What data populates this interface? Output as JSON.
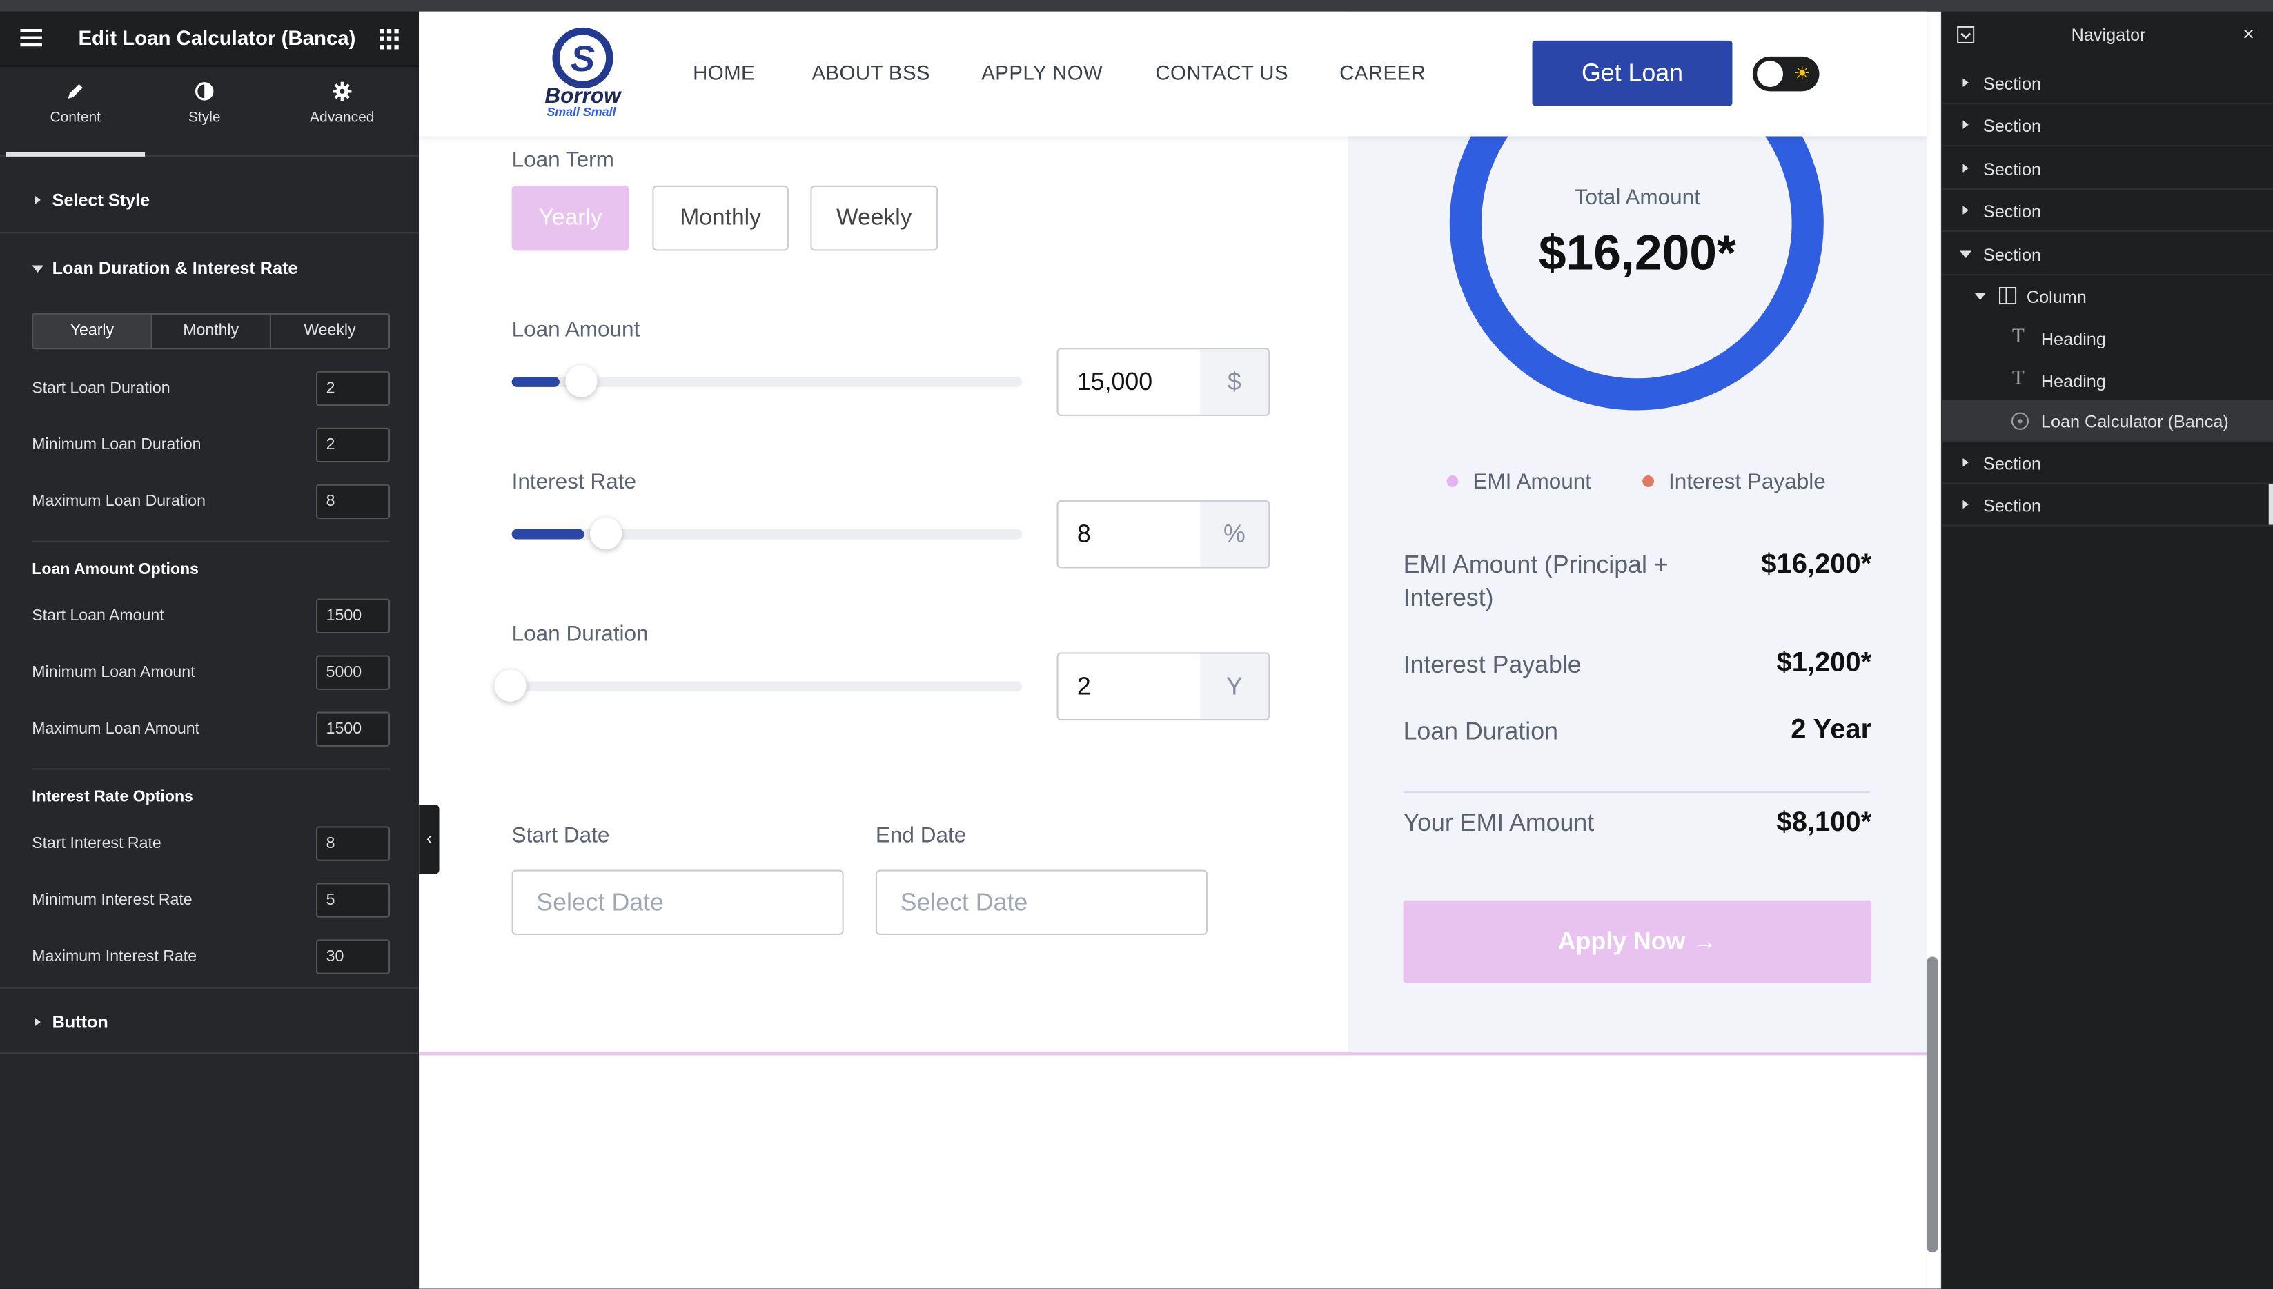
{
  "left_panel": {
    "title": "Edit Loan Calculator (Banca)",
    "tabs": [
      {
        "label": "Content"
      },
      {
        "label": "Style"
      },
      {
        "label": "Advanced"
      }
    ],
    "sections": [
      {
        "label": "Select Style"
      },
      {
        "label": "Loan Duration & Interest Rate"
      },
      {
        "label": "Button"
      }
    ],
    "term_segment": [
      "Yearly",
      "Monthly",
      "Weekly"
    ],
    "duration_fields": [
      {
        "label": "Start Loan Duration",
        "value": "2"
      },
      {
        "label": "Minimum Loan Duration",
        "value": "2"
      },
      {
        "label": "Maximum Loan Duration",
        "value": "8"
      }
    ],
    "amount_group_title": "Loan Amount Options",
    "amount_fields": [
      {
        "label": "Start Loan Amount",
        "value": "1500"
      },
      {
        "label": "Minimum Loan Amount",
        "value": "5000"
      },
      {
        "label": "Maximum Loan Amount",
        "value": "1500"
      }
    ],
    "rate_group_title": "Interest Rate Options",
    "rate_fields": [
      {
        "label": "Start Interest Rate",
        "value": "8"
      },
      {
        "label": "Minimum Interest Rate",
        "value": "5"
      },
      {
        "label": "Maximum Interest Rate",
        "value": "30"
      }
    ]
  },
  "site_nav": {
    "logo_text": "Borrow",
    "logo_sub": "Small Small",
    "links": [
      "HOME",
      "ABOUT BSS",
      "APPLY NOW",
      "CONTACT US",
      "CAREER"
    ],
    "cta": "Get Loan",
    "toggle_icon": "☀"
  },
  "calculator": {
    "loan_term_label": "Loan Term",
    "terms": [
      "Yearly",
      "Monthly",
      "Weekly"
    ],
    "active_term": "Yearly",
    "loan_amount": {
      "label": "Loan Amount",
      "value": "15,000",
      "unit": "$",
      "slider_fraction": 0.07
    },
    "interest_rate": {
      "label": "Interest Rate",
      "value": "8",
      "unit": "%",
      "slider_fraction": 0.12
    },
    "loan_duration": {
      "label": "Loan Duration",
      "value": "2",
      "unit": "Y",
      "slider_fraction": 0.0
    },
    "start_date": {
      "label": "Start Date",
      "placeholder": "Select Date"
    },
    "end_date": {
      "label": "End Date",
      "placeholder": "Select Date"
    }
  },
  "summary": {
    "total_label": "Total Amount",
    "total_value": "$16,200*",
    "legend": [
      {
        "label": "EMI Amount",
        "color": "#e3b3ee"
      },
      {
        "label": "Interest Payable",
        "color": "#e07a5f"
      }
    ],
    "rows": [
      {
        "label": "EMI Amount (Principal + Interest)",
        "value": "$16,200*"
      },
      {
        "label": "Interest Payable",
        "value": "$1,200*"
      },
      {
        "label": "Loan Duration",
        "value": "2 Year"
      }
    ],
    "your_emi_label": "Your EMI Amount",
    "your_emi_value": "$8,100*",
    "apply_label": "Apply Now →",
    "ring_color": "#2f5ee0"
  },
  "navigator": {
    "title": "Navigator",
    "items": [
      "Section",
      "Section",
      "Section",
      "Section",
      "Section",
      "Column",
      "Heading",
      "Heading",
      "Loan Calculator (Banca)",
      "Section",
      "Section"
    ]
  }
}
